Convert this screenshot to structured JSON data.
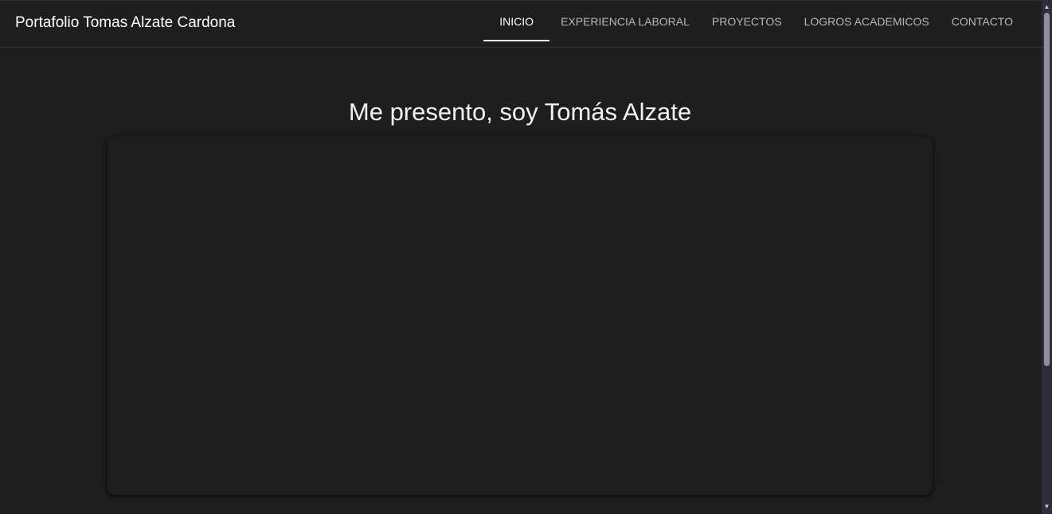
{
  "header": {
    "brand": "Portafolio Tomas Alzate Cardona",
    "tabs": [
      {
        "label": "INICIO",
        "active": true
      },
      {
        "label": "EXPERIENCIA LABORAL",
        "active": false
      },
      {
        "label": "PROYECTOS",
        "active": false
      },
      {
        "label": "LOGROS ACADEMICOS",
        "active": false
      },
      {
        "label": "CONTACTO",
        "active": false
      }
    ]
  },
  "main": {
    "heading": "Me presento, soy Tomás Alzate"
  },
  "scrollbar": {
    "up_icon": "chevron-up-icon",
    "down_icon": "chevron-down-icon"
  },
  "colors": {
    "background": "#1e1e1e",
    "active_indicator": "#ffffff",
    "inactive_tab_text": "#b8b8b8"
  }
}
